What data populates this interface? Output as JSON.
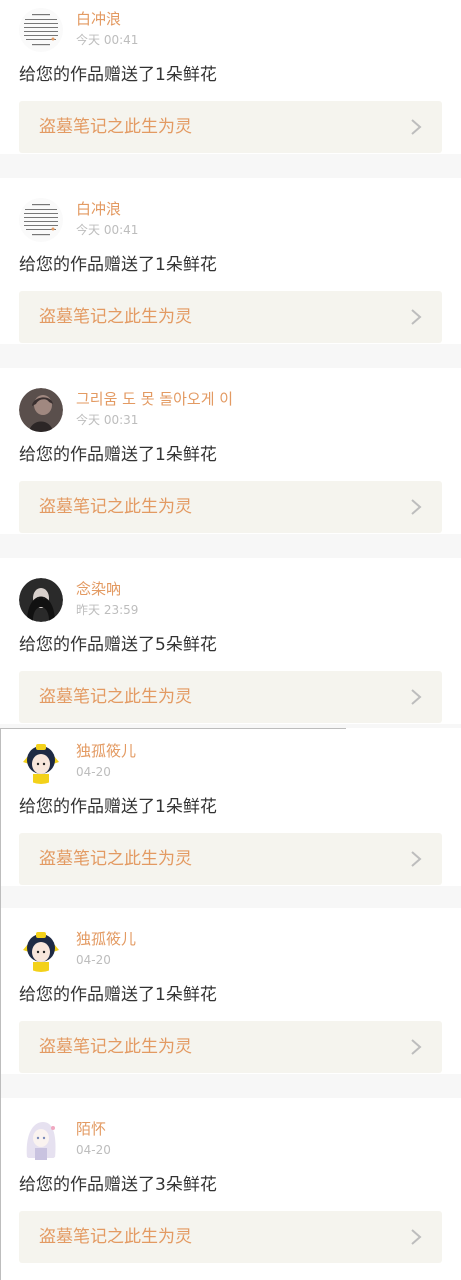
{
  "notifications": [
    {
      "user": "白冲浪",
      "time": "今天 00:41",
      "message": "给您的作品赠送了1朵鲜花",
      "work_title": "盗墓笔记之此生为灵",
      "avatar": "text-avatar"
    },
    {
      "user": "白冲浪",
      "time": "今天 00:41",
      "message": "给您的作品赠送了1朵鲜花",
      "work_title": "盗墓笔记之此生为灵",
      "avatar": "text-avatar"
    },
    {
      "user": "그리움 도 못 돌아오게 이",
      "time": "今天 00:31",
      "message": "给您的作品赠送了1朵鲜花",
      "work_title": "盗墓笔记之此生为灵",
      "avatar": "person-avatar"
    },
    {
      "user": "念染吶",
      "time": "昨天 23:59",
      "message": "给您的作品赠送了5朵鲜花",
      "work_title": "盗墓笔记之此生为灵",
      "avatar": "girl-dark-hair-avatar"
    },
    {
      "user": "独孤筱儿",
      "time": "04-20",
      "message": "给您的作品赠送了1朵鲜花",
      "work_title": "盗墓笔记之此生为灵",
      "avatar": "cartoon-girl-avatar"
    },
    {
      "user": "独孤筱儿",
      "time": "04-20",
      "message": "给您的作品赠送了1朵鲜花",
      "work_title": "盗墓笔记之此生为灵",
      "avatar": "cartoon-girl-avatar"
    },
    {
      "user": "陌怀",
      "time": "04-20",
      "message": "给您的作品赠送了3朵鲜花",
      "work_title": "盗墓笔记之此生为灵",
      "avatar": "anime-girl-avatar"
    }
  ],
  "colors": {
    "accent": "#e39a62",
    "text": "#333333",
    "muted": "#bdbdbd",
    "work_bg": "#f5f4ee",
    "page_bg": "#f7f7f7"
  },
  "icons": {
    "work_chevron": "chevron-right-icon"
  }
}
